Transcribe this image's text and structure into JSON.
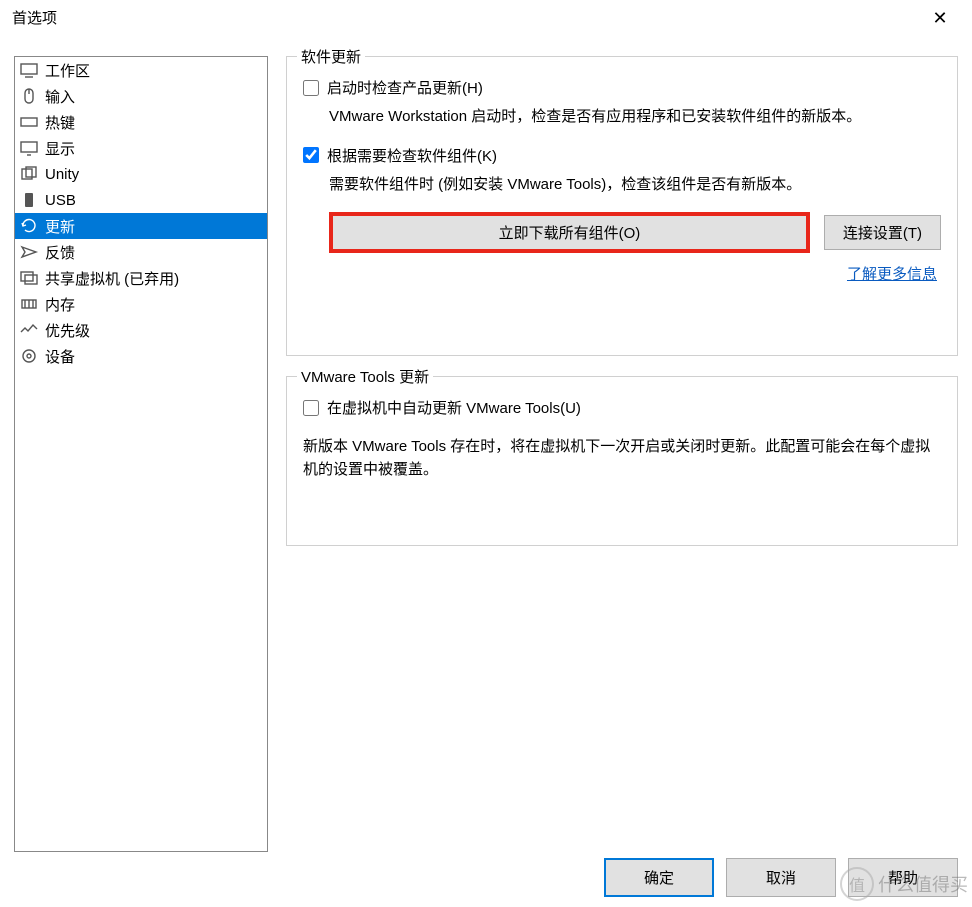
{
  "window": {
    "title": "首选项"
  },
  "sidebar": {
    "items": [
      {
        "label": "工作区",
        "icon": "workspace"
      },
      {
        "label": "输入",
        "icon": "input"
      },
      {
        "label": "热键",
        "icon": "hotkeys"
      },
      {
        "label": "显示",
        "icon": "display"
      },
      {
        "label": "Unity",
        "icon": "unity"
      },
      {
        "label": "USB",
        "icon": "usb"
      },
      {
        "label": "更新",
        "icon": "update",
        "selected": true
      },
      {
        "label": "反馈",
        "icon": "feedback"
      },
      {
        "label": "共享虚拟机 (已弃用)",
        "icon": "shared-vm"
      },
      {
        "label": "内存",
        "icon": "memory"
      },
      {
        "label": "优先级",
        "icon": "priority"
      },
      {
        "label": "设备",
        "icon": "devices"
      }
    ]
  },
  "software_updates": {
    "legend": "软件更新",
    "check_startup": {
      "label": "启动时检查产品更新(H)",
      "checked": false,
      "desc": "VMware Workstation 启动时，检查是否有应用程序和已安装软件组件的新版本。"
    },
    "check_components": {
      "label": "根据需要检查软件组件(K)",
      "checked": true,
      "desc": "需要软件组件时 (例如安装 VMware Tools)，检查该组件是否有新版本。"
    },
    "download_button": "立即下载所有组件(O)",
    "connection_button": "连接设置(T)",
    "learn_more_link": "了解更多信息"
  },
  "tools_updates": {
    "legend": "VMware Tools 更新",
    "auto_update": {
      "label": "在虚拟机中自动更新 VMware Tools(U)",
      "checked": false
    },
    "desc": "新版本 VMware Tools 存在时，将在虚拟机下一次开启或关闭时更新。此配置可能会在每个虚拟机的设置中被覆盖。"
  },
  "buttons": {
    "ok": "确定",
    "cancel": "取消",
    "help": "帮助"
  },
  "watermark": {
    "badge": "值",
    "text": "什么值得买"
  }
}
